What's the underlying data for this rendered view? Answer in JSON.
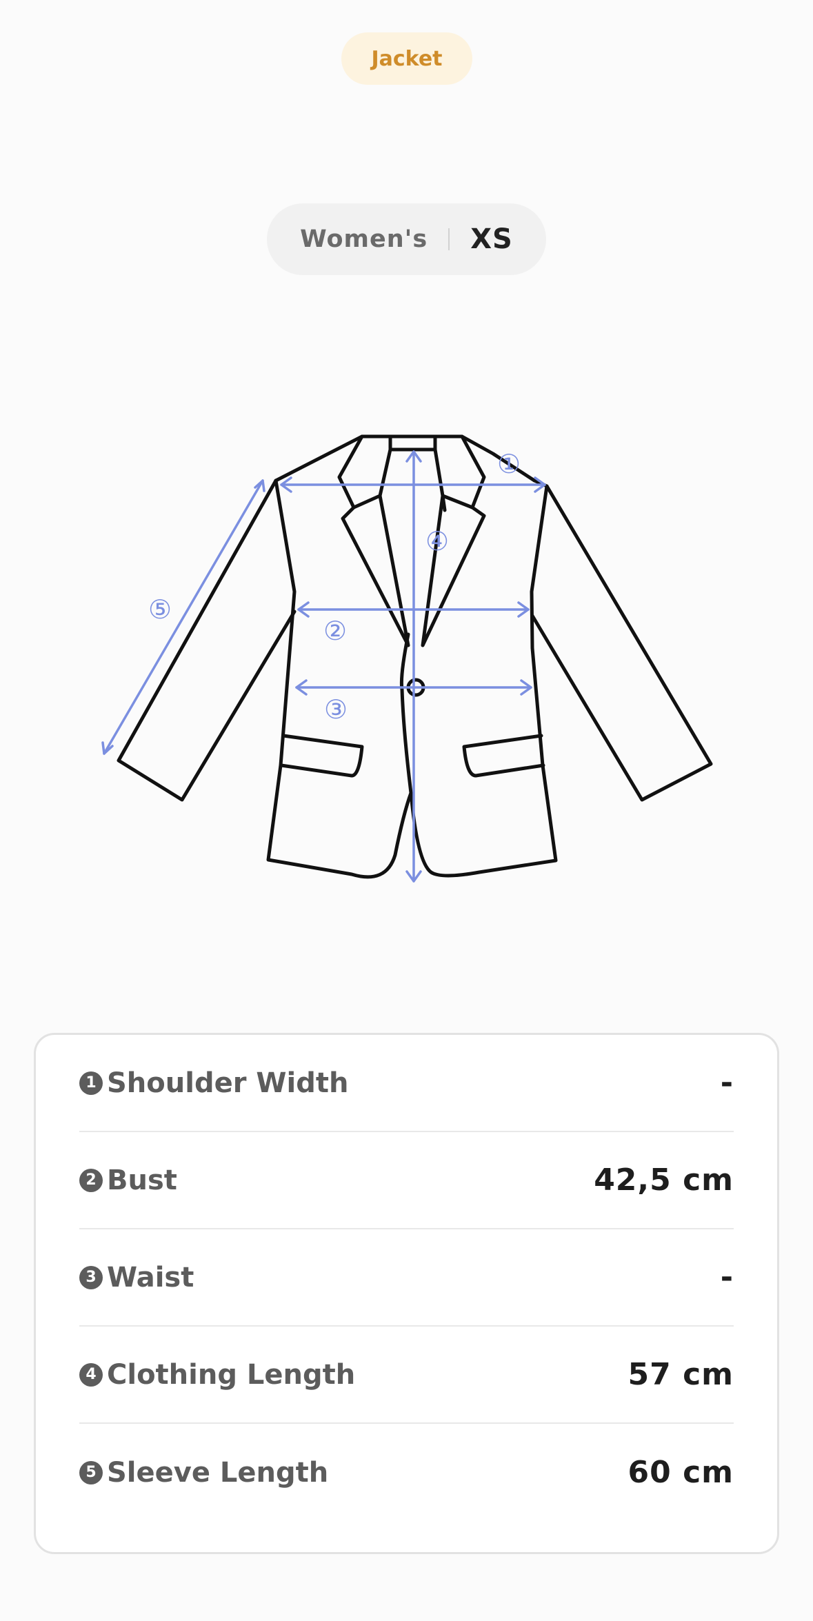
{
  "category": "Jacket",
  "size": {
    "gender": "Women's",
    "value": "XS"
  },
  "diagram": {
    "markers": [
      "①",
      "②",
      "③",
      "④",
      "⑤"
    ],
    "arrow_color": "#7b8fe0"
  },
  "measurements": [
    {
      "num": "1",
      "label": "Shoulder Width",
      "value": "-"
    },
    {
      "num": "2",
      "label": "Bust",
      "value": "42,5 cm"
    },
    {
      "num": "3",
      "label": "Waist",
      "value": "-"
    },
    {
      "num": "4",
      "label": "Clothing Length",
      "value": "57 cm"
    },
    {
      "num": "5",
      "label": "Sleeve Length",
      "value": "60 cm"
    }
  ],
  "colors": {
    "accent": "#cf8c2a",
    "accent_bg": "#fdf3df",
    "measure_arrow": "#7b8fe0"
  }
}
